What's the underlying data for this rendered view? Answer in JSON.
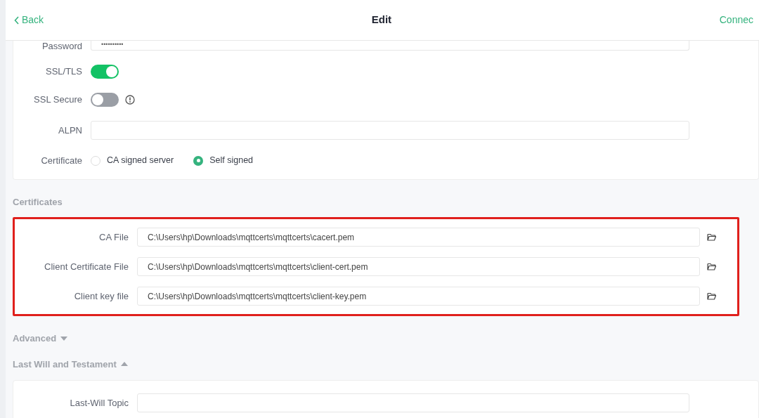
{
  "header": {
    "back": "Back",
    "title": "Edit",
    "action": "Connec"
  },
  "general": {
    "password": {
      "label": "Password",
      "value": "••••••••••"
    },
    "toggles": [
      {
        "label": "SSL/TLS",
        "on": true,
        "info": false
      },
      {
        "label": "SSL Secure",
        "on": false,
        "info": true
      }
    ],
    "alpn": {
      "label": "ALPN"
    },
    "certificate": {
      "label": "Certificate",
      "options": [
        {
          "label": "CA signed server",
          "selected": false
        },
        {
          "label": "Self signed",
          "selected": true
        }
      ]
    }
  },
  "certificates": {
    "title": "Certificates",
    "highlighted": true,
    "files": [
      {
        "label": "CA File",
        "value": "C:\\Users\\hp\\Downloads\\mqttcerts\\mqttcerts\\cacert.pem"
      },
      {
        "label": "Client Certificate File",
        "value": "C:\\Users\\hp\\Downloads\\mqttcerts\\mqttcerts\\client-cert.pem"
      },
      {
        "label": "Client key file",
        "value": "C:\\Users\\hp\\Downloads\\mqttcerts\\mqttcerts\\client-key.pem"
      }
    ]
  },
  "sections": [
    {
      "title": "Advanced",
      "expanded": false
    },
    {
      "title": "Last Will and Testament",
      "expanded": true
    }
  ],
  "last_will": {
    "topic": {
      "label": "Last-Will Topic"
    }
  }
}
